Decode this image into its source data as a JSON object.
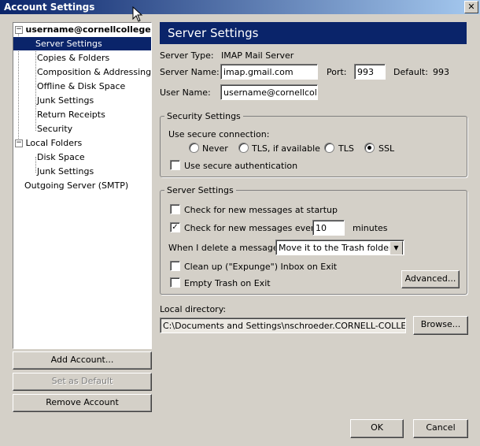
{
  "window": {
    "title": "Account Settings",
    "close_glyph": "✕"
  },
  "tree": {
    "account": "username@cornellcollege....",
    "account_children": [
      "Server Settings",
      "Copies & Folders",
      "Composition & Addressing",
      "Offline & Disk Space",
      "Junk Settings",
      "Return Receipts",
      "Security"
    ],
    "local_folders": "Local Folders",
    "local_children": [
      "Disk Space",
      "Junk Settings"
    ],
    "outgoing": "Outgoing Server (SMTP)",
    "selected": "Server Settings"
  },
  "left_buttons": {
    "add_account": "Add Account...",
    "set_default": "Set as Default",
    "remove_account": "Remove Account"
  },
  "panel": {
    "header": "Server Settings",
    "server_type_label": "Server Type:",
    "server_type_value": "IMAP Mail Server",
    "server_name_label": "Server Name:",
    "server_name_value": "imap.gmail.com",
    "port_label": "Port:",
    "port_value": "993",
    "default_label": "Default:",
    "default_value": "993",
    "user_name_label": "User Name:",
    "user_name_value": "username@cornellcollege"
  },
  "security": {
    "legend": "Security Settings",
    "use_secure_label": "Use secure connection:",
    "options": [
      "Never",
      "TLS, if available",
      "TLS",
      "SSL"
    ],
    "selected": "SSL",
    "secure_auth_label": "Use secure authentication",
    "secure_auth_checked": false
  },
  "server": {
    "legend": "Server Settings",
    "check_startup_label": "Check for new messages at startup",
    "check_startup_checked": false,
    "check_every_label": "Check for new messages every",
    "check_every_checked": true,
    "check_every_value": "10",
    "minutes_label": "minutes",
    "delete_label": "When I delete a message:",
    "delete_value": "Move it to the Trash folder",
    "expunge_label": "Clean up (\"Expunge\") Inbox on Exit",
    "expunge_checked": false,
    "empty_trash_label": "Empty Trash on Exit",
    "empty_trash_checked": false,
    "advanced_label": "Advanced..."
  },
  "local_dir": {
    "label": "Local directory:",
    "value": "C:\\Documents and Settings\\nschroeder.CORNELL-COLLEGE\\App",
    "browse_label": "Browse..."
  },
  "dialog_buttons": {
    "ok": "OK",
    "cancel": "Cancel"
  },
  "colors": {
    "title_gradient_start": "#0a246a",
    "title_gradient_end": "#a6caf0",
    "selection": "#0a246a",
    "face": "#d4d0c8"
  },
  "icons": {
    "check_glyph": "✓",
    "dropdown_glyph": "▼",
    "expand_glyph": "−"
  }
}
